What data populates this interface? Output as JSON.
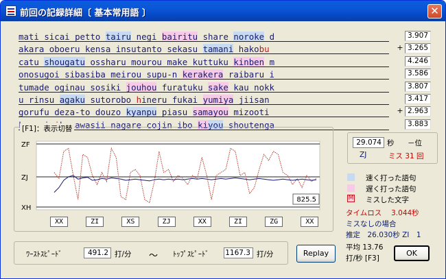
{
  "window": {
    "title": "前回の記録詳細〔 基本常用語 〕",
    "close_label": "✕"
  },
  "lines": [
    {
      "segments": [
        [
          "mati ",
          ""
        ],
        [
          "sicai ",
          ""
        ],
        [
          "petto ",
          ""
        ],
        [
          "tairu",
          "fast"
        ],
        [
          " negi ",
          ""
        ],
        [
          "bairitu",
          "slow"
        ],
        [
          " share ",
          ""
        ],
        [
          "noroke",
          "fast"
        ],
        [
          " d",
          ""
        ]
      ],
      "mark": "",
      "time": "3.907"
    },
    {
      "segments": [
        [
          "akara oboeru kensa insutanto sekasu ",
          ""
        ],
        [
          "tamani",
          "fast"
        ],
        [
          " hako",
          ""
        ],
        [
          "bu",
          "miss"
        ],
        [
          "_",
          ""
        ]
      ],
      "mark": "+",
      "time": "3.265"
    },
    {
      "segments": [
        [
          "catu ",
          ""
        ],
        [
          "shougatu",
          "fast"
        ],
        [
          " ossharu mourou make kuttuku_",
          ""
        ],
        [
          "kinben",
          "slow"
        ],
        [
          " m",
          ""
        ]
      ],
      "mark": "",
      "time": "4.246"
    },
    {
      "segments": [
        [
          "onosugoi sibasiba meirou supu-n ",
          ""
        ],
        [
          "kerakera",
          "slow"
        ],
        [
          " raibaru i",
          ""
        ]
      ],
      "mark": "",
      "time": "3.586"
    },
    {
      "segments": [
        [
          "tumade oginau sosiki ",
          ""
        ],
        [
          "jouhou",
          "slow"
        ],
        [
          " furatuku ",
          ""
        ],
        [
          "sake",
          "slow"
        ],
        [
          " kau nokk",
          ""
        ]
      ],
      "mark": "",
      "time": "3.807"
    },
    {
      "segments": [
        [
          "u",
          ""
        ],
        [
          " rinsu_",
          ""
        ],
        [
          "agaku",
          "fast"
        ],
        [
          " sutorobo ",
          ""
        ],
        [
          "h",
          "miss"
        ],
        [
          "ineru fukai ",
          ""
        ],
        [
          "yumiya",
          "slow"
        ],
        [
          " jiisan",
          ""
        ]
      ],
      "mark": "",
      "time": "3.417"
    },
    {
      "segments": [
        [
          "gorufu deza-to douzo ",
          ""
        ],
        [
          "kyanpu",
          "fast"
        ],
        [
          " piasu ",
          ""
        ],
        [
          "samayou",
          "slow"
        ],
        [
          " mizooti",
          ""
        ]
      ],
      "mark": "+",
      "time": "2.963"
    },
    {
      "segments": [
        [
          "kusuri ",
          ""
        ],
        [
          "i",
          "miss"
        ],
        [
          "kagawasii nagare cojin ibo_",
          ""
        ],
        [
          "ki",
          "slow"
        ],
        [
          "you",
          "fast"
        ],
        [
          " shoutenga",
          ""
        ]
      ],
      "mark": "",
      "time": "3.883"
    }
  ],
  "graph": {
    "group_label": "[F1]：表示切替",
    "ylabels": {
      "top": "ZF",
      "mid": "ZJ",
      "bottom": "XH"
    },
    "readout": "825.5",
    "xlabels": [
      "XX",
      "ZI",
      "XS",
      "ZJ",
      "XX",
      "ZI",
      "ZG",
      "XX"
    ]
  },
  "chart_data": {
    "type": "line",
    "series": [
      {
        "values": [
          0.55,
          0.45,
          0.9,
          0.95,
          0.5,
          0.1,
          0.85,
          0.8,
          0.5,
          0.35,
          0.55,
          0.4,
          0.95,
          0.8,
          0.15,
          0.1,
          0.55,
          0.6,
          0.5,
          0.1,
          0.05,
          0.4,
          0.9,
          0.55,
          0.6,
          0.4,
          0.5,
          0.45,
          0.35,
          0.5,
          0.45,
          0.8,
          0.5,
          0.1,
          0.5,
          0.55,
          0.6,
          0.95,
          0.9,
          0.5,
          0.55,
          0.2,
          0.3,
          0.6,
          0.85,
          0.75,
          0.9,
          0.85,
          0.55,
          0.5,
          0.35,
          0.45,
          0.3,
          0.5,
          0.4,
          0.45
        ]
      },
      {
        "values": [
          0.22,
          0.3,
          0.42,
          0.48,
          0.5,
          0.44,
          0.46,
          0.47,
          0.42,
          0.43,
          0.45,
          0.44,
          0.46,
          0.45,
          0.44,
          0.42,
          0.43,
          0.44,
          0.43,
          0.42,
          0.41,
          0.43,
          0.44,
          0.43,
          0.44,
          0.43,
          0.44,
          0.43,
          0.44,
          0.45,
          0.44,
          0.45,
          0.44,
          0.43,
          0.44,
          0.45,
          0.44,
          0.45,
          0.46,
          0.45,
          0.44,
          0.43,
          0.44,
          0.45,
          0.44,
          0.43,
          0.42,
          0.43,
          0.44,
          0.43,
          0.42,
          0.43,
          0.44,
          0.43,
          0.42,
          0.43
        ]
      }
    ]
  },
  "side": {
    "total_time": "29.074",
    "sec_label": "秒",
    "rank_label": "－位",
    "rank_grade": "ZJ",
    "miss_label": "ミス 31 回",
    "legend_fast": "速く打った語句",
    "legend_slow": "遅く打った語句",
    "legend_miss_glyph": "M",
    "legend_miss": "ミスした文字",
    "time_loss": "タイムロス　 3.044秒",
    "no_miss_title": "ミスなしの場合",
    "estimate": "推定　26.030秒 ZI　1",
    "avg_line1": "平均 13.76",
    "avg_line2": "打/秒 [F3]"
  },
  "bottom": {
    "worst_label": "ﾜｰｽﾄｽﾋﾟｰﾄﾞ",
    "worst_value": "491.2",
    "unit1": "打/分",
    "tilde": "～",
    "top_label": "ﾄｯﾌﾟｽﾋﾟｰﾄﾞ",
    "top_value": "1167.3",
    "unit2": "打/分"
  },
  "buttons": {
    "replay": "Replay",
    "ok": "OK"
  },
  "colors": {
    "fast": "#c6daf2",
    "slow": "#f7cbe8",
    "miss": "#c01818",
    "graph_main": "#b23a2a",
    "graph_avg": "#17176b"
  }
}
